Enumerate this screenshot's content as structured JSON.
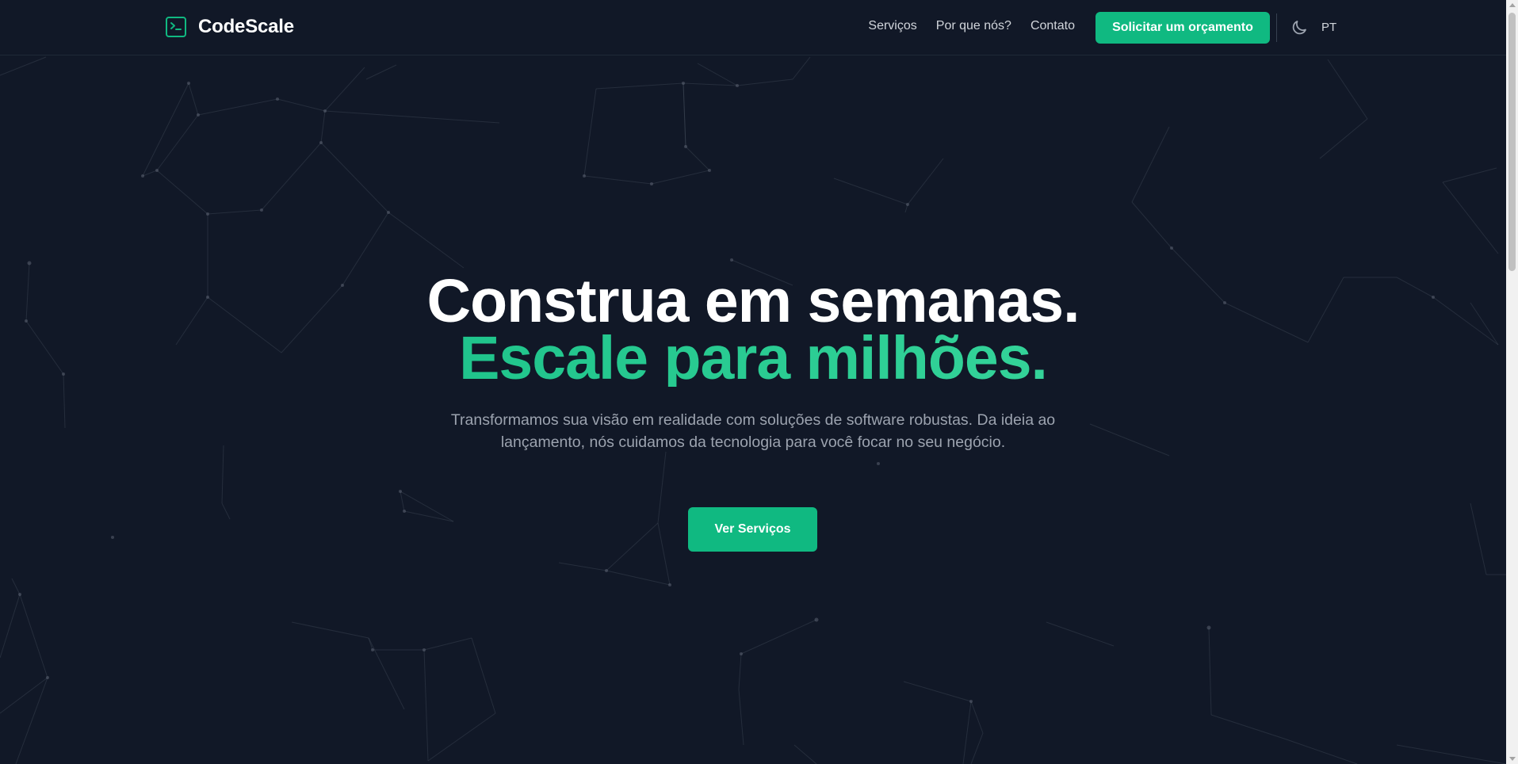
{
  "brand": {
    "name": "CodeScale",
    "icon": "terminal-icon"
  },
  "nav": {
    "items": [
      {
        "label": "Serviços"
      },
      {
        "label": "Por que nós?"
      },
      {
        "label": "Contato"
      }
    ],
    "cta_label": "Solicitar um orçamento",
    "theme_icon": "moon-icon",
    "language": "PT"
  },
  "hero": {
    "headline_line1": "Construa em semanas.",
    "headline_line2": "Escale para milhões.",
    "subtitle": "Transformamos sua visão em realidade com soluções de software robustas. Da ideia ao lançamento, nós cuidamos da tecnologia para você focar no seu negócio.",
    "cta_label": "Ver Serviços"
  },
  "colors": {
    "background": "#111827",
    "accent": "#10b981",
    "text_muted": "#9ca3af",
    "nav_text": "#d1d5db"
  }
}
